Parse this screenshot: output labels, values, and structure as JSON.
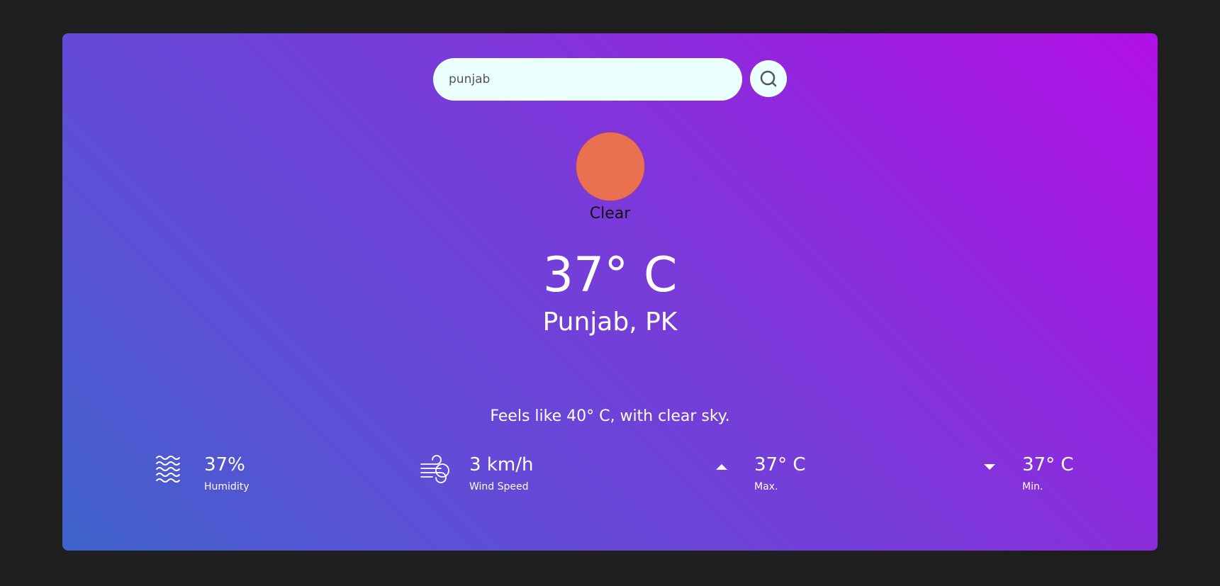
{
  "search": {
    "value": "punjab",
    "placeholder": ""
  },
  "weather": {
    "condition": "Clear",
    "temperature": "37° C",
    "location": "Punjab, PK",
    "feels_like": "Feels like 40° C, with clear sky.",
    "icon": "sun-icon",
    "icon_color": "#ea714f"
  },
  "stats": {
    "humidity": {
      "value": "37%",
      "label": "Humidity",
      "icon": "water-waves-icon"
    },
    "wind": {
      "value": "3 km/h",
      "label": "Wind Speed",
      "icon": "wind-icon"
    },
    "max": {
      "value": "37° C",
      "label": "Max.",
      "icon": "caret-up-icon"
    },
    "min": {
      "value": "37° C",
      "label": "Min.",
      "icon": "caret-down-icon"
    }
  },
  "colors": {
    "background": "#1f1f1f",
    "gradient_start": "#3f63cc",
    "gradient_end": "#b20fe6",
    "search_bg": "#ebfffc"
  }
}
